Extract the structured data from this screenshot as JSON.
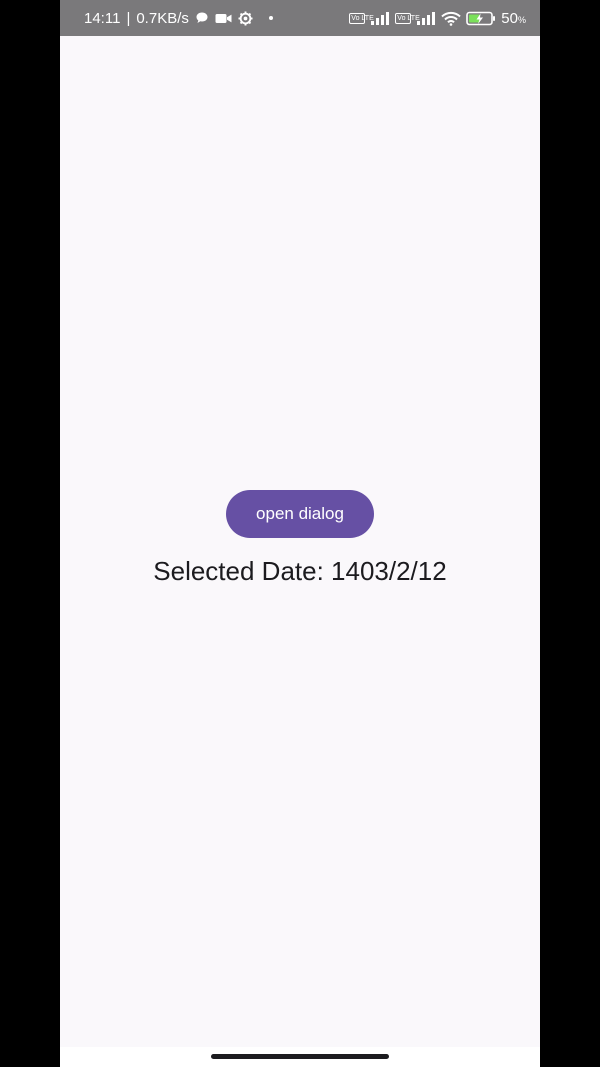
{
  "status_bar": {
    "time": "14:11",
    "separator": "|",
    "network_speed": "0.7KB/s",
    "volte_label": "Vo LTE",
    "battery_percent": "50",
    "battery_unit": "%",
    "icons": [
      "chat-bubble-icon",
      "video-camera-icon",
      "settings-gear-icon",
      "volte-icon",
      "signal-icon",
      "wifi-icon",
      "battery-charging-icon"
    ]
  },
  "main": {
    "button_label": "open dialog",
    "selected_date_text": "Selected Date: 1403/2/12"
  },
  "colors": {
    "status_bar_bg": "#7a797b",
    "screen_bg": "#faf8fb",
    "button_bg": "#6650a4",
    "button_text": "#ffffff",
    "text": "#1c1b1f"
  }
}
